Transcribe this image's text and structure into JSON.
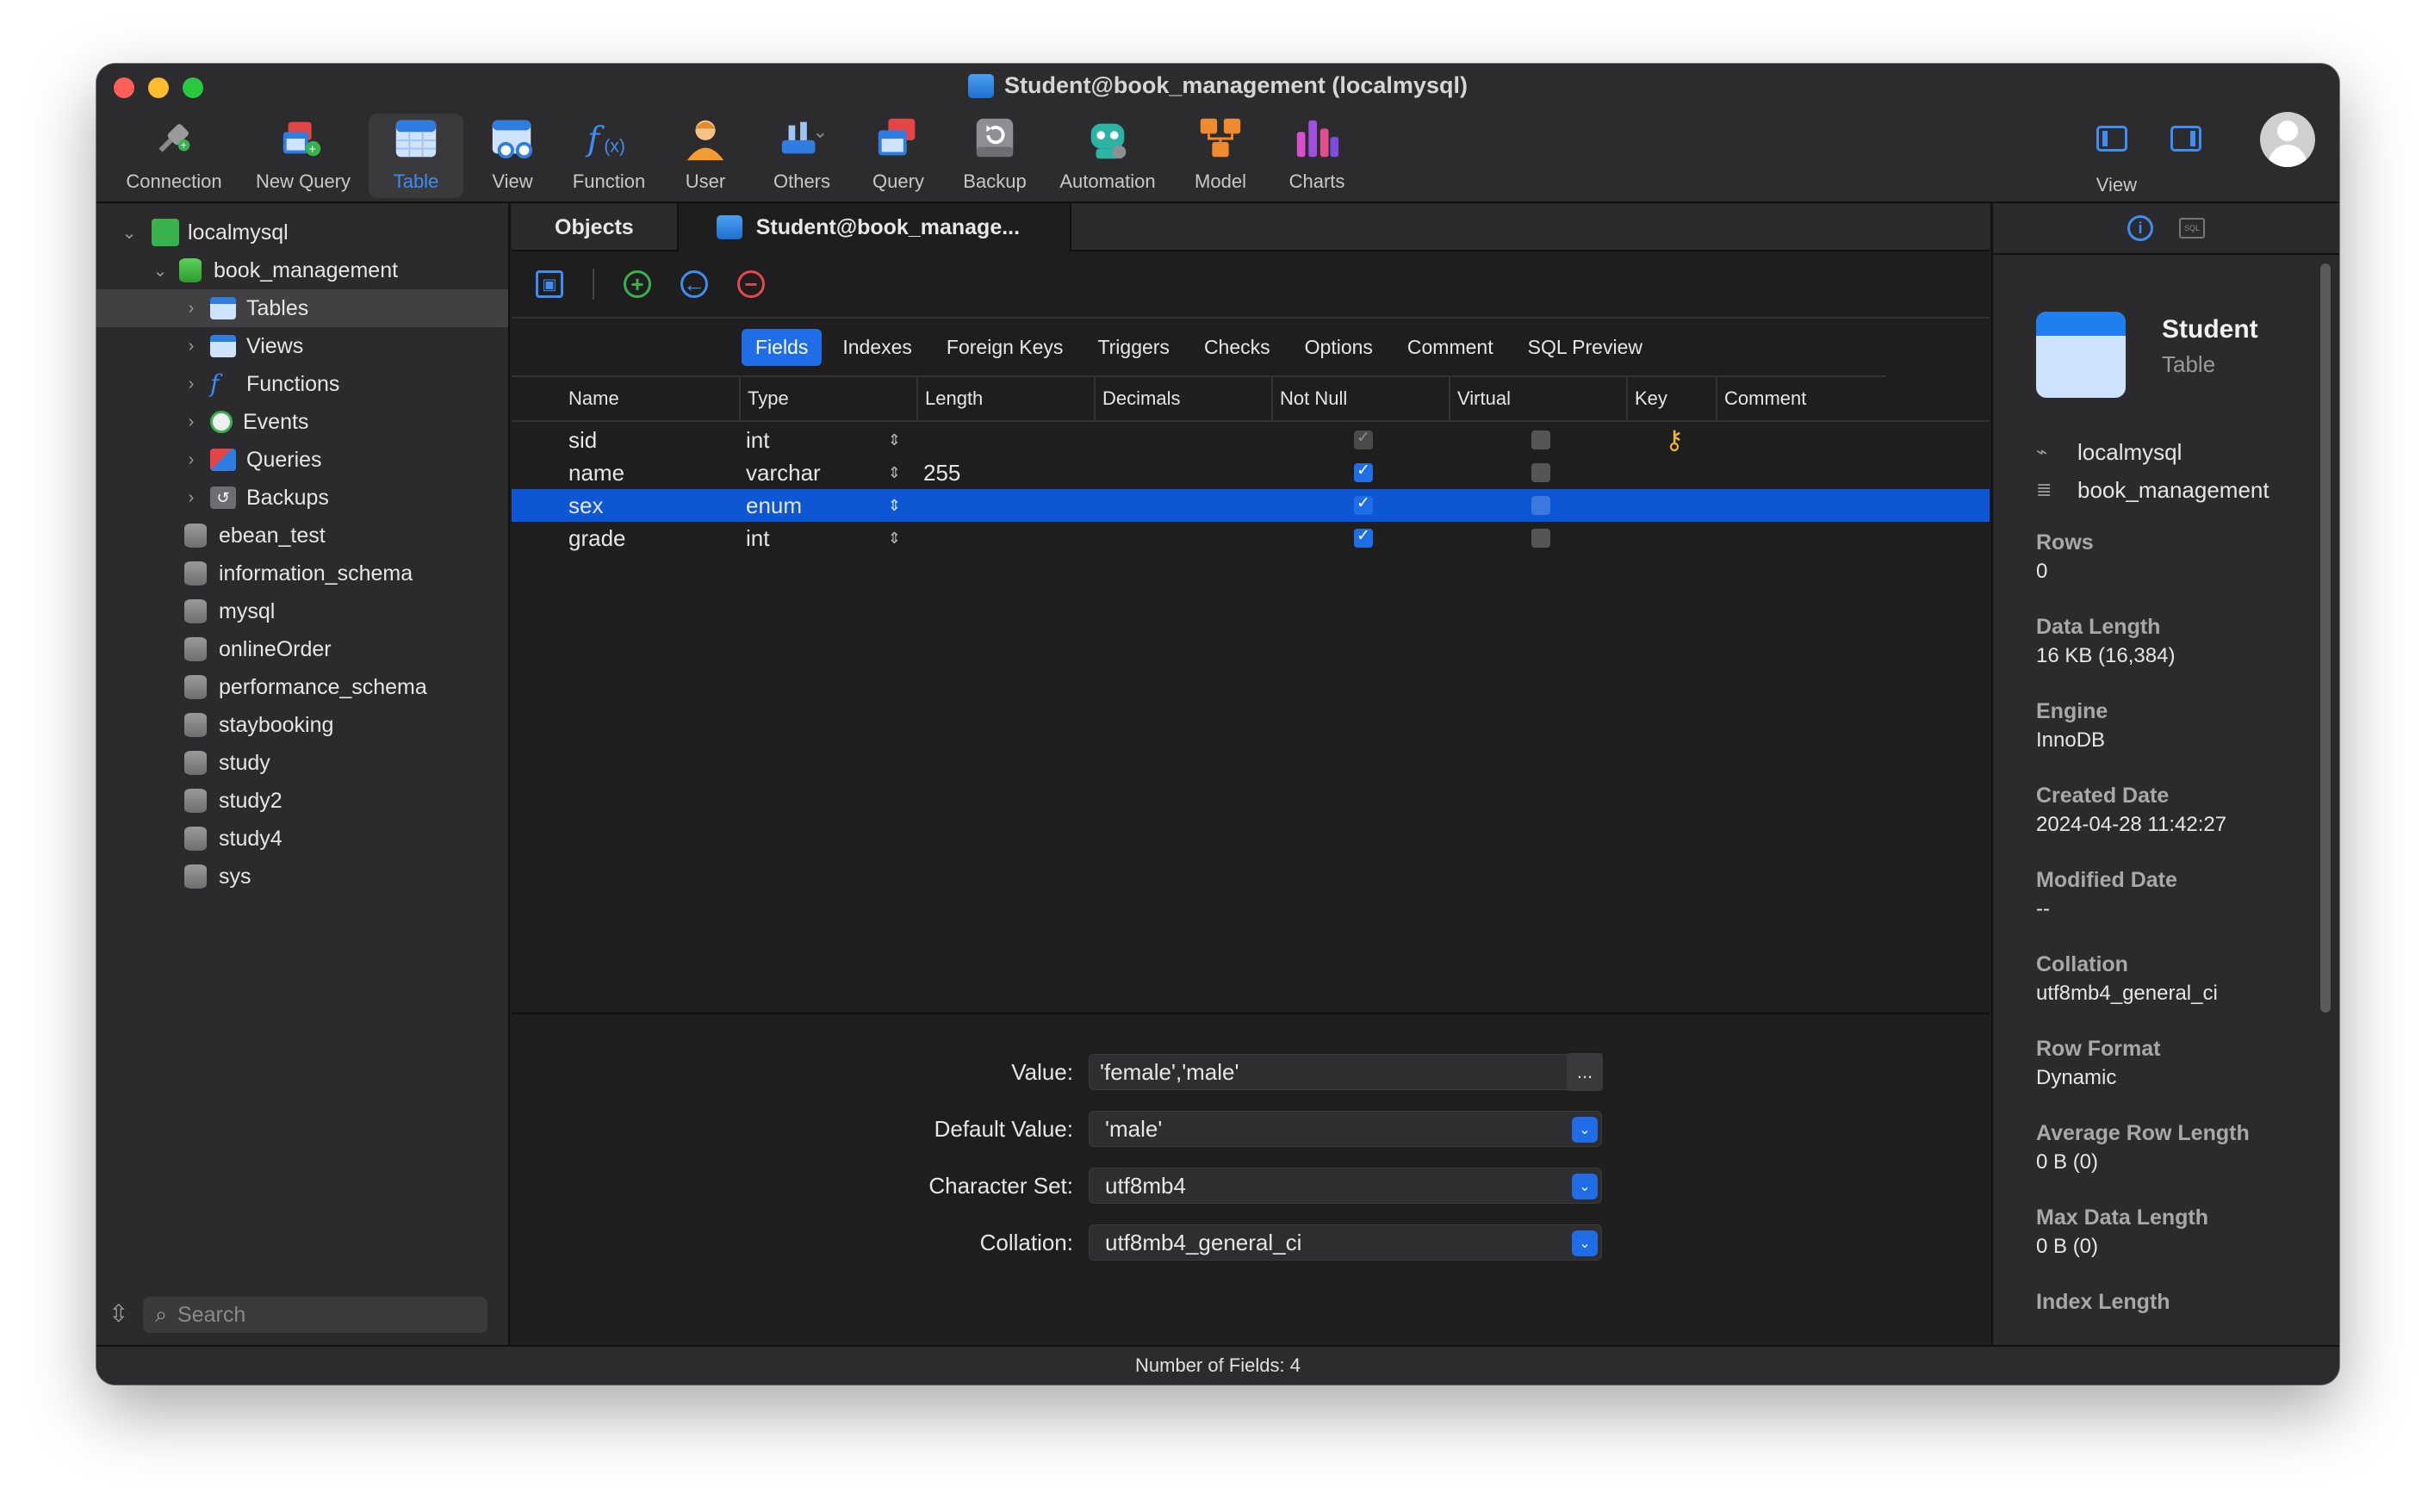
{
  "window": {
    "title": "Student@book_management (localmysql)"
  },
  "toolbar": {
    "items": [
      {
        "label": "Connection",
        "icon": "connection-icon"
      },
      {
        "label": "New Query",
        "icon": "new-query-icon"
      },
      {
        "label": "Table",
        "icon": "table-icon",
        "active": true
      },
      {
        "label": "View",
        "icon": "view-icon"
      },
      {
        "label": "Function",
        "icon": "function-icon"
      },
      {
        "label": "User",
        "icon": "user-icon"
      },
      {
        "label": "Others",
        "icon": "others-icon"
      },
      {
        "label": "Query",
        "icon": "query-icon"
      },
      {
        "label": "Backup",
        "icon": "backup-icon"
      },
      {
        "label": "Automation",
        "icon": "automation-icon"
      },
      {
        "label": "Model",
        "icon": "model-icon"
      },
      {
        "label": "Charts",
        "icon": "charts-icon"
      }
    ],
    "view_label": "View"
  },
  "sidebar": {
    "connection": "localmysql",
    "database": "book_management",
    "groups": [
      {
        "label": "Tables",
        "selected": true
      },
      {
        "label": "Views"
      },
      {
        "label": "Functions"
      },
      {
        "label": "Events"
      },
      {
        "label": "Queries"
      },
      {
        "label": "Backups"
      }
    ],
    "databases": [
      "ebean_test",
      "information_schema",
      "mysql",
      "onlineOrder",
      "performance_schema",
      "staybooking",
      "study",
      "study2",
      "study4",
      "sys"
    ],
    "search_placeholder": "Search"
  },
  "tabs": {
    "objects": "Objects",
    "active": "Student@book_manage..."
  },
  "subtabs": [
    "Fields",
    "Indexes",
    "Foreign Keys",
    "Triggers",
    "Checks",
    "Options",
    "Comment",
    "SQL Preview"
  ],
  "grid": {
    "headers": [
      "Name",
      "Type",
      "Length",
      "Decimals",
      "Not Null",
      "Virtual",
      "Key",
      "Comment"
    ],
    "rows": [
      {
        "name": "sid",
        "type": "int",
        "length": "",
        "decimals": "",
        "not_null": true,
        "not_null_disabled": true,
        "virtual": false,
        "key": true,
        "comment": ""
      },
      {
        "name": "name",
        "type": "varchar",
        "length": "255",
        "decimals": "",
        "not_null": true,
        "virtual": false,
        "key": false,
        "comment": ""
      },
      {
        "name": "sex",
        "type": "enum",
        "length": "",
        "decimals": "",
        "not_null": true,
        "virtual": false,
        "key": false,
        "comment": "",
        "selected": true
      },
      {
        "name": "grade",
        "type": "int",
        "length": "",
        "decimals": "",
        "not_null": true,
        "virtual": false,
        "key": false,
        "comment": ""
      }
    ]
  },
  "detail": {
    "value_label": "Value:",
    "value": "'female','male'",
    "ellipsis": "...",
    "default_label": "Default Value:",
    "default_value": "'male'",
    "charset_label": "Character Set:",
    "charset": "utf8mb4",
    "collation_label": "Collation:",
    "collation": "utf8mb4_general_ci"
  },
  "info": {
    "name": "Student",
    "type": "Table",
    "connection": "localmysql",
    "database": "book_management",
    "props": [
      {
        "label": "Rows",
        "value": "0"
      },
      {
        "label": "Data Length",
        "value": "16 KB (16,384)"
      },
      {
        "label": "Engine",
        "value": "InnoDB"
      },
      {
        "label": "Created Date",
        "value": "2024-04-28 11:42:27"
      },
      {
        "label": "Modified Date",
        "value": "--"
      },
      {
        "label": "Collation",
        "value": "utf8mb4_general_ci"
      },
      {
        "label": "Row Format",
        "value": "Dynamic"
      },
      {
        "label": "Average Row Length",
        "value": "0 B (0)"
      },
      {
        "label": "Max Data Length",
        "value": "0 B (0)"
      },
      {
        "label": "Index Length",
        "value": ""
      }
    ]
  },
  "status": "Number of Fields: 4",
  "colors": {
    "accent": "#1f6ee8",
    "selection": "#0d56d4",
    "background": "#1e1e1e"
  }
}
